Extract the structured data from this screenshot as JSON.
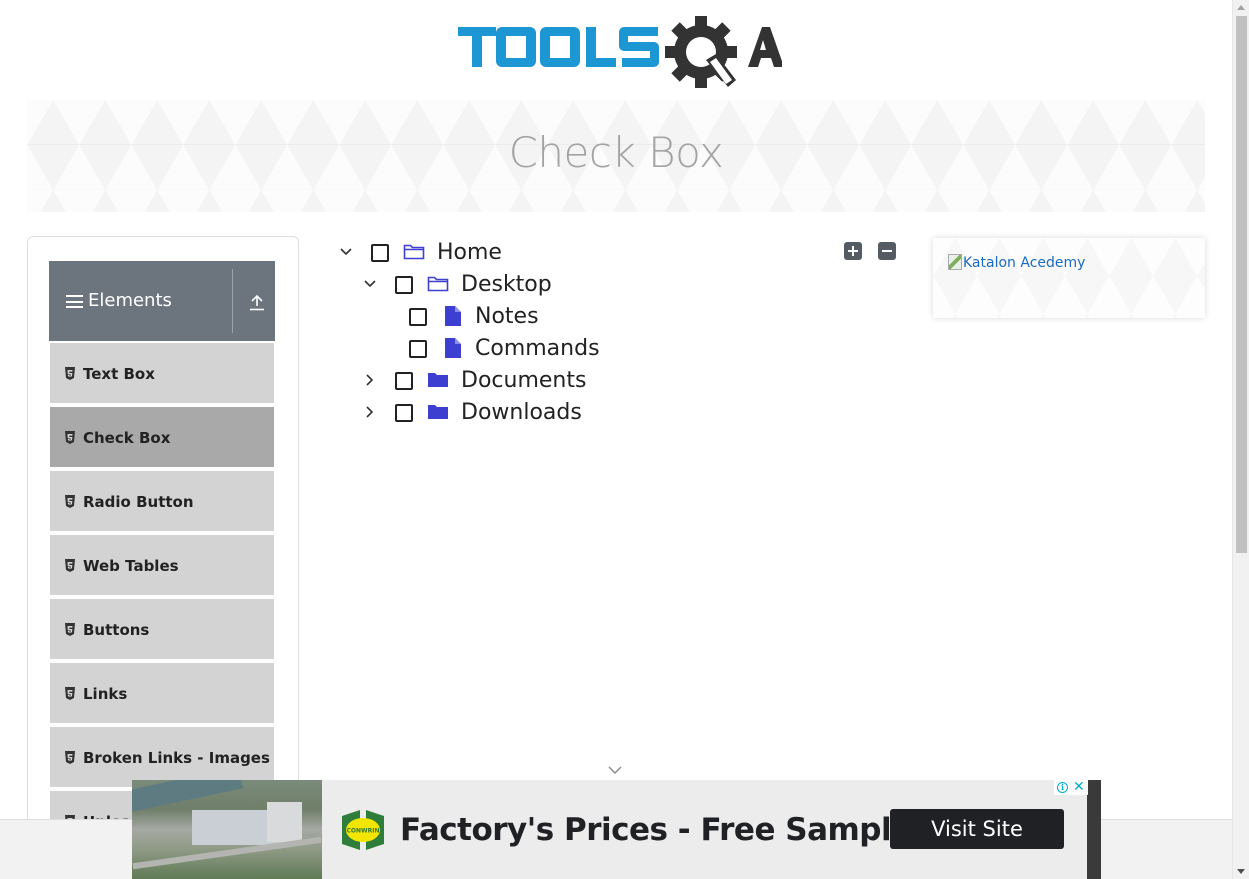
{
  "header": {
    "logo_alt": "TOOLSQA"
  },
  "page": {
    "title": "Check Box"
  },
  "sidebar": {
    "group_title": "Elements",
    "items": [
      {
        "label": "Text Box",
        "active": false
      },
      {
        "label": "Check Box",
        "active": true
      },
      {
        "label": "Radio Button",
        "active": false
      },
      {
        "label": "Web Tables",
        "active": false
      },
      {
        "label": "Buttons",
        "active": false
      },
      {
        "label": "Links",
        "active": false
      },
      {
        "label": "Broken Links - Images",
        "active": false
      },
      {
        "label": "Upload and Download",
        "active": false
      }
    ]
  },
  "tree": {
    "nodes": [
      {
        "label": "Home",
        "type": "folder-open",
        "expanded": true,
        "checked": false
      },
      {
        "label": "Desktop",
        "type": "folder-open",
        "expanded": true,
        "checked": false
      },
      {
        "label": "Notes",
        "type": "file",
        "checked": false
      },
      {
        "label": "Commands",
        "type": "file",
        "checked": false
      },
      {
        "label": "Documents",
        "type": "folder",
        "expanded": false,
        "checked": false
      },
      {
        "label": "Downloads",
        "type": "folder",
        "expanded": false,
        "checked": false
      }
    ],
    "expand_all_label": "+",
    "collapse_all_label": "−"
  },
  "right_ad": {
    "alt_text": "Katalon Acedemy"
  },
  "bottom_ad": {
    "headline": "Factory's Prices - Free Sample",
    "cta": "Visit Site",
    "brand": "CONWRIN"
  },
  "colors": {
    "logo_blue": "#1d96d4",
    "logo_dark": "#333333",
    "sidebar_header": "#6c757d",
    "menu_item": "#d3d3d3",
    "menu_item_active": "#a9a9a9",
    "tree_icon": "#3c3fcf",
    "banner_title": "#a3a3a3"
  }
}
